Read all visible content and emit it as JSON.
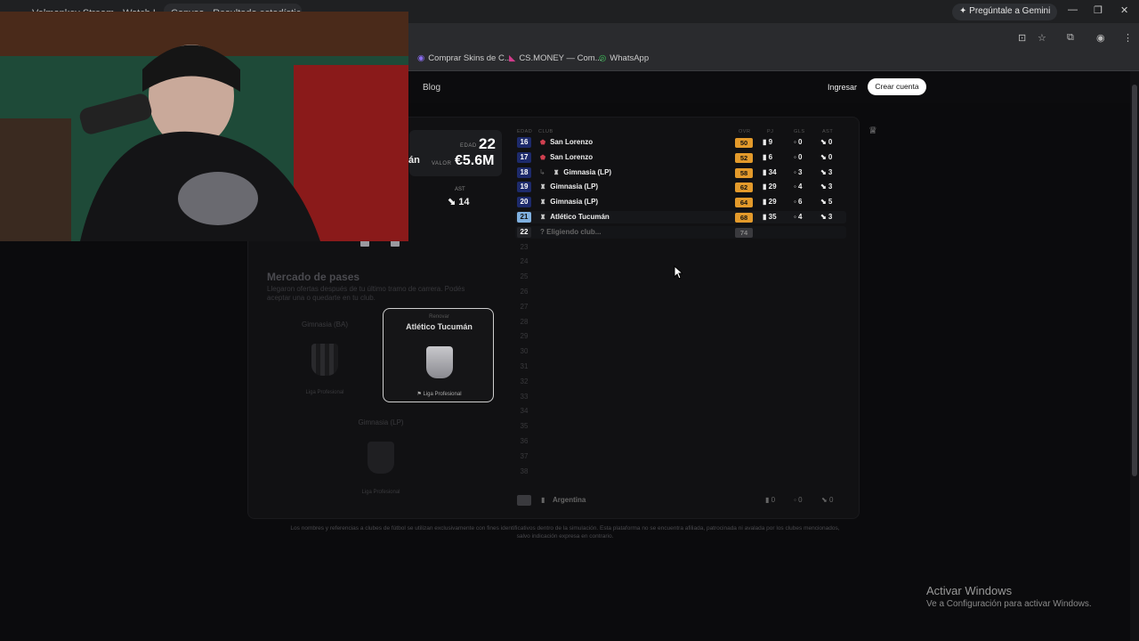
{
  "browser": {
    "tabs": [
      {
        "title": "Velmonkey Stream - Watch Li..."
      },
      {
        "title": "Canvas - Resultado estadístico..."
      }
    ],
    "gemini_label": "Pregúntale a Gemini",
    "bookmarks": [
      {
        "label": "Comprar Skins de C..."
      },
      {
        "label": "CS.MONEY — Com..."
      },
      {
        "label": "WhatsApp"
      }
    ]
  },
  "site": {
    "nav": {
      "blog": "Blog",
      "login": "Ingresar",
      "signup": "Crear cuenta"
    },
    "profile": {
      "name_fragment": "án",
      "age_label": "EDAD",
      "age": "22",
      "value_label": "VALOR",
      "value": "€5.6M",
      "ast_label": "AST",
      "ast": "14"
    },
    "career": {
      "headers": {
        "age": "EDAD",
        "club": "CLUB",
        "ovr": "OVR",
        "pj": "PJ",
        "gls": "GLS",
        "ast": "AST"
      },
      "rows": [
        {
          "age": "16",
          "club": "San Lorenzo",
          "ovr": "50",
          "pj": "9",
          "gls": "0",
          "ast": "0",
          "ovr_color": "#e39a2b",
          "age_color": "#1d2a6b",
          "loan": false
        },
        {
          "age": "17",
          "club": "San Lorenzo",
          "ovr": "52",
          "pj": "6",
          "gls": "0",
          "ast": "0",
          "ovr_color": "#e39a2b",
          "age_color": "#1d2a6b",
          "loan": false
        },
        {
          "age": "18",
          "club": "Gimnasia (LP)",
          "ovr": "58",
          "pj": "34",
          "gls": "3",
          "ast": "3",
          "ovr_color": "#e39a2b",
          "age_color": "#1d2a6b",
          "loan": true
        },
        {
          "age": "19",
          "club": "Gimnasia (LP)",
          "ovr": "62",
          "pj": "29",
          "gls": "4",
          "ast": "3",
          "ovr_color": "#e39a2b",
          "age_color": "#1d2a6b",
          "loan": false
        },
        {
          "age": "20",
          "club": "Gimnasia (LP)",
          "ovr": "64",
          "pj": "29",
          "gls": "6",
          "ast": "5",
          "ovr_color": "#e39a2b",
          "age_color": "#1d2a6b",
          "loan": false
        },
        {
          "age": "21",
          "club": "Atlético Tucumán",
          "ovr": "68",
          "pj": "35",
          "gls": "4",
          "ast": "3",
          "ovr_color": "#e39a2b",
          "age_color": "#7fb0e0",
          "loan": false
        }
      ],
      "current": {
        "age": "22",
        "club": "Eligiendo club...",
        "ovr": "74"
      },
      "empty_ages": [
        "23",
        "24",
        "25",
        "26",
        "27",
        "28",
        "29",
        "30",
        "31",
        "32",
        "33",
        "34",
        "35",
        "36",
        "37",
        "38"
      ],
      "footer": {
        "country": "Argentina",
        "pj": "0",
        "gls": "0",
        "ast": "0"
      }
    },
    "market": {
      "title": "Mercado de pases",
      "subtitle": "Llegaron ofertas después de tu último tramo de carrera. Podés aceptar una o quedarte en tu club.",
      "offers": [
        {
          "club": "Gimnasia (BA)",
          "league": "Liga Profesional"
        },
        {
          "club": "Atlético Tucumán",
          "tag": "Renovar",
          "league": "Liga Profesional"
        },
        {
          "club": "Gimnasia (LP)",
          "league": "Liga Profesional"
        }
      ]
    },
    "disclaimer": "Los nombres y referencias a clubes de fútbol se utilizan exclusivamente con fines identificativos dentro de la simulación. Esta plataforma no se encuentra afiliada, patrocinada ni avalada por los clubes mencionados, salvo indicación expresa en contrario."
  },
  "windows": {
    "activate_title": "Activar Windows",
    "activate_sub": "Ve a Configuración para activar Windows."
  }
}
